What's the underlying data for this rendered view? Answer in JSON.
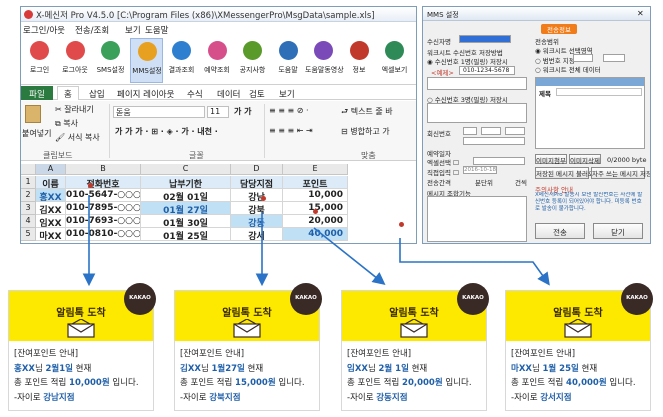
{
  "main_window": {
    "title": "X-메신저 Pro V4.5.0 [C:\\Program Files (x86)\\XMessengerPro\\MsgData\\sample.xls]",
    "menu": [
      "로그인/아웃",
      "전송/조회",
      "보기",
      "도움말"
    ],
    "toolbar": [
      "로그인",
      "로그아웃",
      "SMS설정",
      "MMS설정",
      "결과조회",
      "예약조회",
      "공지사항",
      "도움말",
      "도움말동영상",
      "정보",
      "엑셀보기"
    ],
    "toolbar_colors": [
      "#e04a4a",
      "#e04a4a",
      "#3aa05a",
      "#e8a020",
      "#2e7fd0",
      "#d64f8a",
      "#5a9a2a",
      "#2f6fb8",
      "#7a4ab8",
      "#c0392b",
      "#2e8b57"
    ],
    "ribbon_tabs": [
      "파일",
      "홈",
      "삽입",
      "페이지 레이아웃",
      "수식",
      "데이터",
      "검토",
      "보기"
    ],
    "ribbon": {
      "cut": "잘라내기",
      "copy": "복사",
      "paste": "붙여넣기",
      "format_copy": "서식 복사",
      "font_name": "돋움",
      "font_size": "11",
      "group_clipboard": "클립보드",
      "group_font": "글꼴",
      "group_align": "맞춤",
      "text_wrap": "텍스트 줄 바",
      "merge": "병합하고 가"
    },
    "columns": [
      "A",
      "B",
      "C",
      "D",
      "E"
    ],
    "rows": [
      [
        "이름",
        "전화번호",
        "납부기한",
        "담당지점",
        "포인트"
      ],
      [
        "홍XX",
        "010-5647-○○○○",
        "02월 01일",
        "강남",
        "10,000"
      ],
      [
        "김XX",
        "010-7895-○○○○",
        "01월 27일",
        "강북",
        "15,000"
      ],
      [
        "임XX",
        "010-7693-○○○○",
        "01월 30일",
        "강동",
        "20,000"
      ],
      [
        "마XX",
        "010-0810-○○○○",
        "01월 25일",
        "강서",
        "40,000"
      ]
    ],
    "row_numbers": [
      "1",
      "2",
      "3",
      "4",
      "5"
    ]
  },
  "dialog": {
    "title": "MMS 설정",
    "send_info": "전송정보",
    "recipient": "수신자명",
    "sheet_phone_save": "워크시트 수신번호 저장방법",
    "option_one": "수신번호 1명(필링) 저장시",
    "example_label": "<예제>",
    "example_value": "010-1234-5678",
    "option_multi": "수신번호 3명(필링) 저장시",
    "reply_number": "회신번호",
    "reserve": "예약일자",
    "sheet_select": "엑셀선택",
    "direct_input": "직접입력",
    "date_value": "2016-10-18",
    "send_interval": "전송간격",
    "per_minute": "분단위",
    "repeat": "건씩",
    "msg_combo": "메시지 조합기능",
    "send_range": "전송범위",
    "opt_sheet_select": "워크시트 선택영역",
    "opt_range": "범번호 지정",
    "opt_all": "워크시트 전체 데이터",
    "title_label": "제목",
    "fmt_btn1": "이미지첨부",
    "fmt_btn2": "이미지삭제",
    "bytes": "0/2000 byte",
    "saved_btn": "저장된 메시지 불러오기",
    "frequent_btn": "자주 쓰는 메시지 저장",
    "notice_title": "주의사항 안내",
    "notice": "X메신저Pro 발송시 보낸 발신번호는 사전에 발신번호 등록이 되어있어야 합니다. 미등록 번호로 발송이 불가합니다.",
    "send": "전송",
    "close": "닫기"
  },
  "cards": [
    {
      "title": "알림톡 도착",
      "badge": "KAKAO",
      "line1": "[잔여포인트 안내]",
      "name": "홍XX",
      "l2mid": "님 ",
      "date": "2월1일",
      "l2end": " 현재",
      "l3pre": "총 포인트 적립 ",
      "points": "10,000원",
      "l3end": " 입니다.",
      "l4pre": "-자이로 ",
      "branch": "강남지점"
    },
    {
      "title": "알림톡 도착",
      "badge": "KAKAO",
      "line1": "[잔여포인트 안내]",
      "name": "김XX",
      "l2mid": "님 ",
      "date": "1월27일",
      "l2end": " 현재",
      "l3pre": "총 포인트 적립 ",
      "points": "15,000원",
      "l3end": " 입니다.",
      "l4pre": "-자이로 ",
      "branch": "강북지점"
    },
    {
      "title": "알림톡 도착",
      "badge": "KAKAO",
      "line1": "[잔여포인트 안내]",
      "name": "임XX",
      "l2mid": "님 ",
      "date": "2월 1일",
      "l2end": " 현재",
      "l3pre": "총 포인트 적립 ",
      "points": "20,000원",
      "l3end": " 입니다.",
      "l4pre": "-자이로 ",
      "branch": "강동지점"
    },
    {
      "title": "알림톡 도착",
      "badge": "KAKAO",
      "line1": "[잔여포인트 안내]",
      "name": "마XX",
      "l2mid": "님 ",
      "date": "1월 25일",
      "l2end": " 현재",
      "l3pre": "총 포인트 적립 ",
      "points": "40,000원",
      "l3end": " 입니다.",
      "l4pre": "-자이로 ",
      "branch": "강서지점"
    }
  ],
  "colors": {
    "arrow": "#2a73c6",
    "kakao_yellow": "#fde800",
    "excel_green": "#2b7a3f",
    "header_blue": "#dcebf7",
    "highlight": "#bfe0f5"
  }
}
